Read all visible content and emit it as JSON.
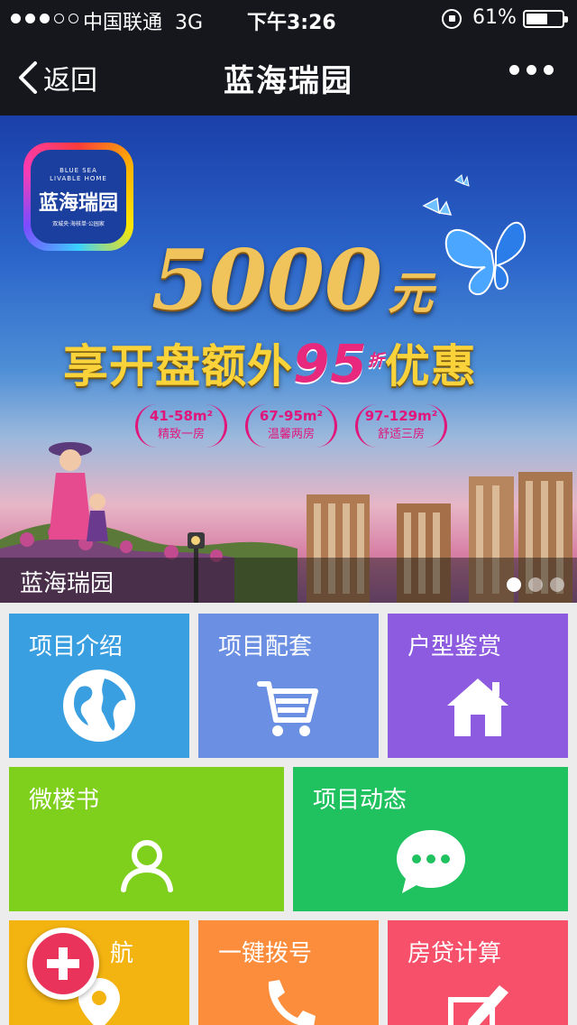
{
  "status_bar": {
    "carrier": "中国联通",
    "network": "3G",
    "time": "下午3:26",
    "battery": "61%",
    "battery_level": 0.61,
    "signal_bars": 3
  },
  "nav": {
    "back_label": "返回",
    "title": "蓝海瑞园"
  },
  "banner": {
    "logo_en_line1": "BLUE SEA",
    "logo_en_line2": "LIVABLE HOME",
    "logo_cn": "蓝海瑞园",
    "logo_sub": "双城央·海核单·公园家",
    "headline_amount": "5000",
    "headline_unit": "元",
    "promo_prefix": "享开盘额外",
    "promo_discount": "95",
    "promo_zhe": "折",
    "promo_suffix": "优惠",
    "tags": [
      {
        "size": "41-58m²",
        "desc": "精致一房"
      },
      {
        "size": "67-95m²",
        "desc": "温馨两房"
      },
      {
        "size": "97-129m²",
        "desc": "舒适三房"
      }
    ],
    "caption": "蓝海瑞园",
    "slide_count": 3,
    "active_slide": 1
  },
  "tiles": [
    {
      "label": "项目介绍",
      "icon": "globe-icon",
      "color": "#3a9fe0"
    },
    {
      "label": "项目配套",
      "icon": "cart-icon",
      "color": "#6a8fe3"
    },
    {
      "label": "户型鉴赏",
      "icon": "house-icon",
      "color": "#8c5be0"
    },
    {
      "label": "微楼书",
      "icon": "user-icon",
      "color": "#7fcf1d"
    },
    {
      "label": "项目动态",
      "icon": "chat-icon",
      "color": "#1fc25f"
    },
    {
      "label": "航",
      "icon": "location-pin-icon",
      "color": "#f3b311"
    },
    {
      "label": "一键拨号",
      "icon": "phone-icon",
      "color": "#fb8d3c"
    },
    {
      "label": "房贷计算",
      "icon": "edit-icon",
      "color": "#f6506a"
    }
  ],
  "fab": {
    "icon": "plus-icon",
    "color": "#e9335a"
  }
}
